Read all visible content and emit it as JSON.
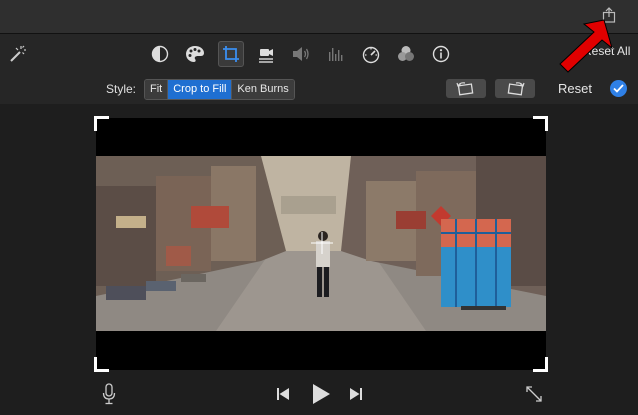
{
  "toolbar": {
    "reset_all_label": "Reset All",
    "tools": [
      "magic-wand-icon",
      "color-balance-icon",
      "color-palette-icon",
      "crop-icon",
      "stabilization-icon",
      "volume-icon",
      "equalizer-icon",
      "speed-icon",
      "overlay-icon",
      "info-icon"
    ],
    "active_tool": "crop-icon"
  },
  "style_bar": {
    "label": "Style:",
    "options": [
      "Fit",
      "Crop to Fill",
      "Ken Burns"
    ],
    "selected": "Crop to Fill",
    "reset_label": "Reset"
  },
  "colors": {
    "accent": "#1f6fd1",
    "annotation_arrow": "#e10000"
  }
}
